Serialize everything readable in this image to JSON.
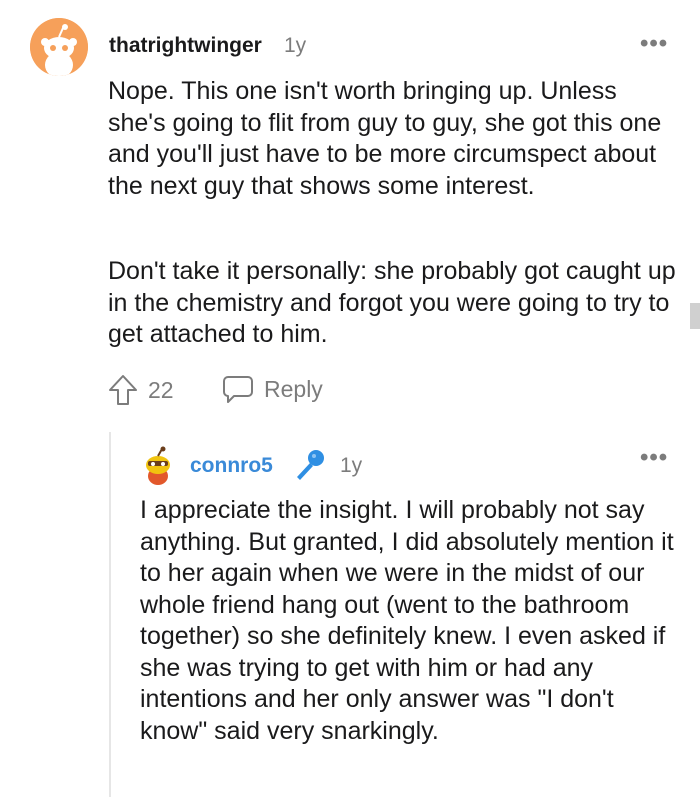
{
  "comment": {
    "username": "thatrightwinger",
    "time": "1y",
    "more": "•••",
    "paragraphs": [
      "Nope. This one isn't worth bringing up. Unless she's going to flit from guy to guy, she got this one and you'll just have to be more circumspect about the next guy that shows some interest.",
      "Don't take it personally: she probably got caught up in the chemistry and forgot you were going to try to get attached to him."
    ],
    "votes": "22",
    "reply_label": "Reply"
  },
  "reply": {
    "username": "connro5",
    "time": "1y",
    "more": "•••",
    "text": "I appreciate the insight. I will probably not say anything. But granted, I did absolutely mention it to her again when we were in the midst of our whole friend hang out (went to the bathroom together) so she definitely knew. I even asked if she was trying to get with him or had any intentions and her only answer was \"I don't know\" said very snarkingly."
  },
  "colors": {
    "username_reply": "#3a8ad8",
    "meta_gray": "#7c7c7c",
    "avatar_orange": "#f6a05a"
  }
}
